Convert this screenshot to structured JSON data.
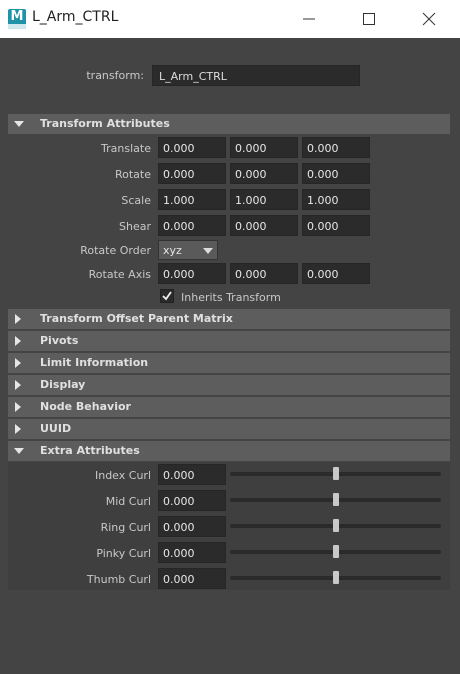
{
  "window": {
    "title": "L_Arm_CTRL",
    "app_icon_letter": "M"
  },
  "transform": {
    "label": "transform:",
    "value": "L_Arm_CTRL"
  },
  "sections": {
    "transform_attributes": "Transform Attributes",
    "transform_offset_parent_matrix": "Transform Offset Parent Matrix",
    "pivots": "Pivots",
    "limit_information": "Limit Information",
    "display": "Display",
    "node_behavior": "Node Behavior",
    "uuid": "UUID",
    "extra_attributes": "Extra Attributes"
  },
  "transform_attributes": {
    "translate": {
      "label": "Translate",
      "x": "0.000",
      "y": "0.000",
      "z": "0.000"
    },
    "rotate": {
      "label": "Rotate",
      "x": "0.000",
      "y": "0.000",
      "z": "0.000"
    },
    "scale": {
      "label": "Scale",
      "x": "1.000",
      "y": "1.000",
      "z": "1.000"
    },
    "shear": {
      "label": "Shear",
      "x": "0.000",
      "y": "0.000",
      "z": "0.000"
    },
    "rotate_order": {
      "label": "Rotate Order",
      "value": "xyz"
    },
    "rotate_axis": {
      "label": "Rotate Axis",
      "x": "0.000",
      "y": "0.000",
      "z": "0.000"
    },
    "inherits_transform": {
      "label": "Inherits Transform",
      "checked": true
    }
  },
  "extra_attributes": {
    "index_curl": {
      "label": "Index Curl",
      "value": "0.000",
      "slider_fraction": 0.5
    },
    "mid_curl": {
      "label": "Mid Curl",
      "value": "0.000",
      "slider_fraction": 0.5
    },
    "ring_curl": {
      "label": "Ring Curl",
      "value": "0.000",
      "slider_fraction": 0.5
    },
    "pinky_curl": {
      "label": "Pinky Curl",
      "value": "0.000",
      "slider_fraction": 0.5
    },
    "thumb_curl": {
      "label": "Thumb Curl",
      "value": "0.000",
      "slider_fraction": 0.5
    }
  },
  "colors": {
    "background": "#444444",
    "section_header": "#5d5d5d",
    "field": "#2b2b2b",
    "titlebar": "#ffffff",
    "app_icon": "#1f93a8"
  }
}
